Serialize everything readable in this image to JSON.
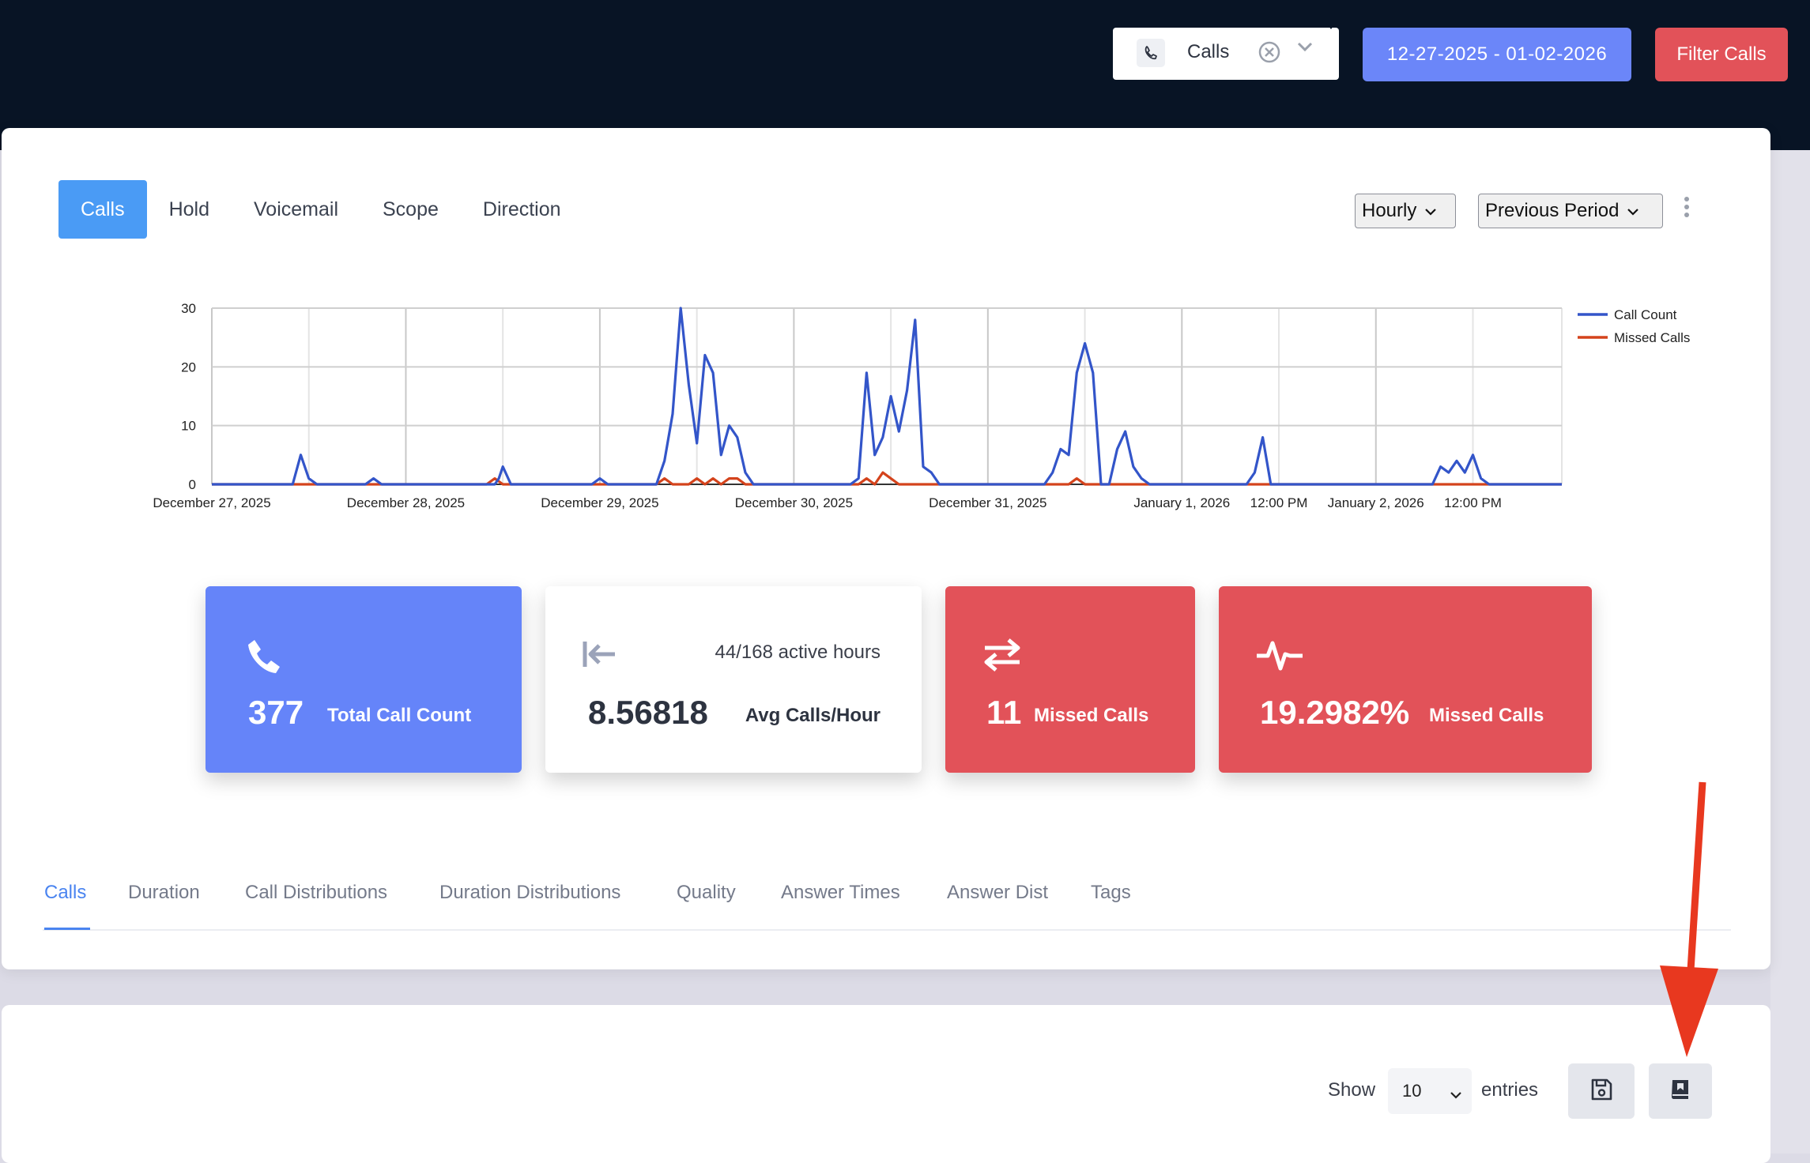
{
  "header": {
    "type_filter": {
      "label": "Calls",
      "icon": "phone-icon"
    },
    "date_range": "12-27-2025 - 01-02-2026",
    "filter_button": "Filter Calls",
    "colors": {
      "topbar": "#081425",
      "date_button": "#6b86f9",
      "filter_button": "#e25259"
    }
  },
  "report_tabs": [
    "Calls",
    "Hold",
    "Voicemail",
    "Scope",
    "Direction"
  ],
  "interval_select": "Hourly",
  "comparison_select": "Previous Period",
  "chart_data": {
    "type": "line",
    "title": "",
    "xlabel": "",
    "ylabel": "",
    "ylim": [
      0,
      30
    ],
    "yticks": [
      0,
      10,
      20,
      30
    ],
    "x_tick_labels": [
      "December 27, 2025",
      "December 28, 2025",
      "December 29, 2025",
      "December 30, 2025",
      "December 31, 2025",
      "January 1, 2026",
      "12:00 PM",
      "January 2, 2026",
      "12:00 PM"
    ],
    "x_unit": "hours since December 27, 2025 00:00",
    "x_range": [
      0,
      167
    ],
    "legend_position": "right",
    "grid": true,
    "series": [
      {
        "name": "Call Count",
        "color": "#3355c9",
        "points": [
          [
            0,
            0
          ],
          [
            10,
            0
          ],
          [
            11,
            5
          ],
          [
            12,
            1
          ],
          [
            13,
            0
          ],
          [
            19,
            0
          ],
          [
            20,
            1
          ],
          [
            21,
            0
          ],
          [
            35,
            0
          ],
          [
            35.5,
            1
          ],
          [
            36,
            3
          ],
          [
            37,
            0
          ],
          [
            47,
            0
          ],
          [
            48,
            1
          ],
          [
            49,
            0
          ],
          [
            55,
            0
          ],
          [
            56,
            4
          ],
          [
            57,
            12
          ],
          [
            58,
            30
          ],
          [
            59,
            17
          ],
          [
            60,
            7
          ],
          [
            61,
            22
          ],
          [
            62,
            19
          ],
          [
            63,
            5
          ],
          [
            64,
            10
          ],
          [
            65,
            8
          ],
          [
            66,
            2
          ],
          [
            67,
            0
          ],
          [
            79,
            0
          ],
          [
            80,
            1
          ],
          [
            81,
            19
          ],
          [
            82,
            5
          ],
          [
            83,
            8
          ],
          [
            84,
            15
          ],
          [
            85,
            9
          ],
          [
            86,
            16
          ],
          [
            87,
            28
          ],
          [
            88,
            3
          ],
          [
            89,
            2
          ],
          [
            90,
            0
          ],
          [
            103,
            0
          ],
          [
            104,
            2
          ],
          [
            105,
            6
          ],
          [
            106,
            5
          ],
          [
            107,
            19
          ],
          [
            108,
            24
          ],
          [
            109,
            19
          ],
          [
            110,
            0
          ],
          [
            111,
            0
          ],
          [
            112,
            6
          ],
          [
            113,
            9
          ],
          [
            114,
            3
          ],
          [
            115,
            1
          ],
          [
            116,
            0
          ],
          [
            128,
            0
          ],
          [
            129,
            2
          ],
          [
            130,
            8
          ],
          [
            131,
            0
          ],
          [
            151,
            0
          ],
          [
            152,
            3
          ],
          [
            153,
            2
          ],
          [
            154,
            4
          ],
          [
            155,
            2
          ],
          [
            156,
            5
          ],
          [
            157,
            1
          ],
          [
            158,
            0
          ],
          [
            167,
            0
          ]
        ]
      },
      {
        "name": "Missed Calls",
        "color": "#d4431c",
        "points": [
          [
            0,
            0
          ],
          [
            34,
            0
          ],
          [
            35,
            1
          ],
          [
            36,
            0
          ],
          [
            55,
            0
          ],
          [
            56,
            1
          ],
          [
            57,
            0
          ],
          [
            59,
            0
          ],
          [
            60,
            1
          ],
          [
            61,
            0
          ],
          [
            62,
            1
          ],
          [
            63,
            0
          ],
          [
            64,
            1
          ],
          [
            65,
            1
          ],
          [
            66,
            0
          ],
          [
            80,
            0
          ],
          [
            81,
            1
          ],
          [
            82,
            0
          ],
          [
            83,
            2
          ],
          [
            84,
            1
          ],
          [
            85,
            0
          ],
          [
            106,
            0
          ],
          [
            107,
            1
          ],
          [
            108,
            0
          ],
          [
            167,
            0
          ]
        ]
      }
    ]
  },
  "stats": [
    {
      "icon": "phone-icon",
      "value": "377",
      "label": "Total Call Count",
      "color": "#6584f9"
    },
    {
      "icon": "arrow-left-bar-icon",
      "extra": "44/168 active hours",
      "value": "8.56818",
      "label": "Avg Calls/Hour",
      "color": "#ffffff"
    },
    {
      "icon": "exchange-arrows-icon",
      "value": "11",
      "label": "Missed Calls",
      "color": "#e25259"
    },
    {
      "icon": "pulse-icon",
      "value": "19.2982%",
      "label": "Missed Calls",
      "color": "#e25259"
    }
  ],
  "detail_tabs": [
    "Calls",
    "Duration",
    "Call Distributions",
    "Duration Distributions",
    "Quality",
    "Answer Times",
    "Answer Dist",
    "Tags"
  ],
  "table_controls": {
    "show_label": "Show",
    "entries_value": "10",
    "entries_label": "entries"
  }
}
